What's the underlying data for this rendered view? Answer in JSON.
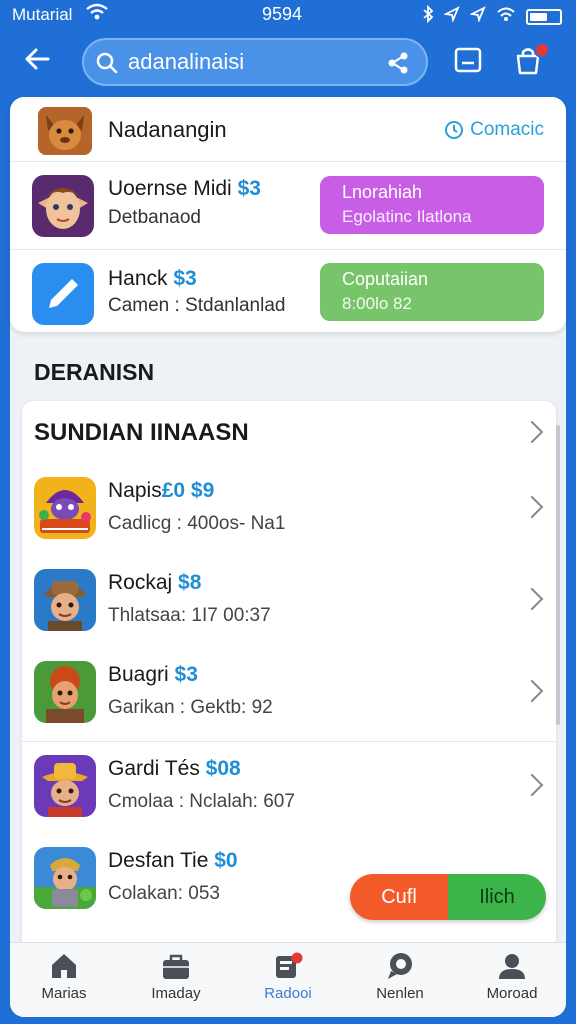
{
  "status_bar": {
    "carrier": "Mutarial",
    "time": "9594",
    "battery_level": 0.6
  },
  "search": {
    "value": "adanalinaisi",
    "placeholder": ""
  },
  "header_row": {
    "title": "Nadanangin",
    "contact_label": "Comacic"
  },
  "offers": [
    {
      "name": "Uoernse Midi",
      "price": "$3",
      "subtitle": "Detbanaod",
      "button_line1": "Lnorahiah",
      "button_line2": "Egolatinc Ilatlona",
      "button_color": "#c95ee6"
    },
    {
      "name": "Hanck",
      "price": "$3",
      "subtitle": "Camen : Stdanlanlad",
      "button_line1": "Coputaiian",
      "button_line2": "8:00lo 82",
      "button_color": "#78c46a"
    }
  ],
  "section_label": "DERANISN",
  "list": {
    "title": "SUNDIAN IINAASN",
    "items": [
      {
        "name": "Napis",
        "price": "£0 $9",
        "subtitle": "Cadlicg : 400os- Na1",
        "icon": "game-icon-wizard"
      },
      {
        "name": "Rockaj",
        "price": "$8",
        "subtitle": "Thlatsaa: 1I7 00:37",
        "icon": "game-icon-explorer"
      },
      {
        "name": "Buagri",
        "price": "$3",
        "subtitle": "Garikan : Gektb: 92",
        "icon": "game-icon-warrior"
      },
      {
        "name": "Gardi Tés",
        "price": "$08",
        "subtitle": "Cmolaa : Nclalah: 607",
        "icon": "game-icon-cowboy"
      },
      {
        "name": "Desfan Tie",
        "price": "$0",
        "subtitle": "Colakan: 053",
        "icon": "game-icon-knight"
      }
    ]
  },
  "split_button": {
    "left_label": "Cufl",
    "right_label": "Ilich"
  },
  "tabs": [
    {
      "label": "Marias",
      "icon": "home-icon"
    },
    {
      "label": "Imaday",
      "icon": "briefcase-icon"
    },
    {
      "label": "Radooi",
      "icon": "notification-icon",
      "active": true
    },
    {
      "label": "Nenlen",
      "icon": "chat-icon"
    },
    {
      "label": "Moroad",
      "icon": "profile-icon"
    }
  ],
  "colors": {
    "primary_blue": "#1f6fd6",
    "accent_blue": "#1e8fd6",
    "badge_red": "#e53935"
  }
}
